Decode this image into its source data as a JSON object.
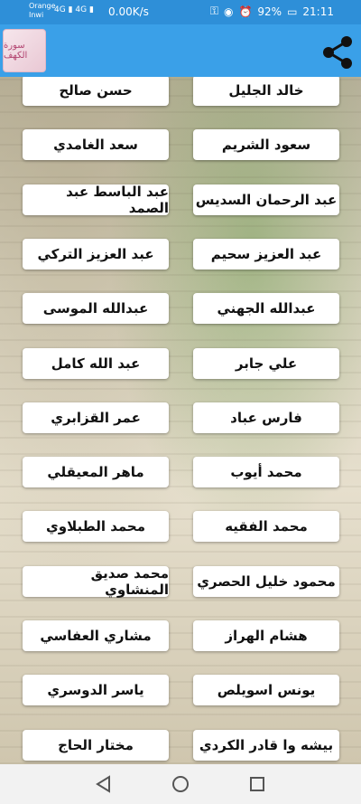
{
  "status_bar": {
    "carrier1": "Orange",
    "carrier2": "Inwi",
    "net1": "4G",
    "net2": "4G",
    "speed": "0.00K/s",
    "battery": "92%",
    "time": "21:11"
  },
  "app": {
    "logo_text": "سورة الكهف"
  },
  "reciters": [
    "خالد الجليل",
    "حسن صالح",
    "سعود الشريم",
    "سعد الغامدي",
    "عبد الرحمان السديس",
    "عبد الباسط عبد الصمد",
    "عبد العزيز سحيم",
    "عبد العزيز التركي",
    "عبدالله الجهني",
    "عبدالله الموسى",
    "علي جابر",
    "عبد الله كامل",
    "فارس عباد",
    "عمر القزابري",
    "محمد أيوب",
    "ماهر المعيقلي",
    "محمد الفقيه",
    "محمد الطبلاوي",
    "محمود خليل الحصري",
    "محمد صديق المنشاوي",
    "هشام الهراز",
    "مشاري العفاسي",
    "يونس اسويلص",
    "ياسر الدوسري",
    "بيشه وا قادر الكردي",
    "مختار الحاج"
  ],
  "colors": {
    "status_bar": "#2e8fd8",
    "app_bar": "#3aa0e8"
  },
  "icons": [
    "share-icon",
    "back-icon",
    "home-icon",
    "recents-icon",
    "signal-icon",
    "wifi-icon",
    "battery-icon"
  ]
}
